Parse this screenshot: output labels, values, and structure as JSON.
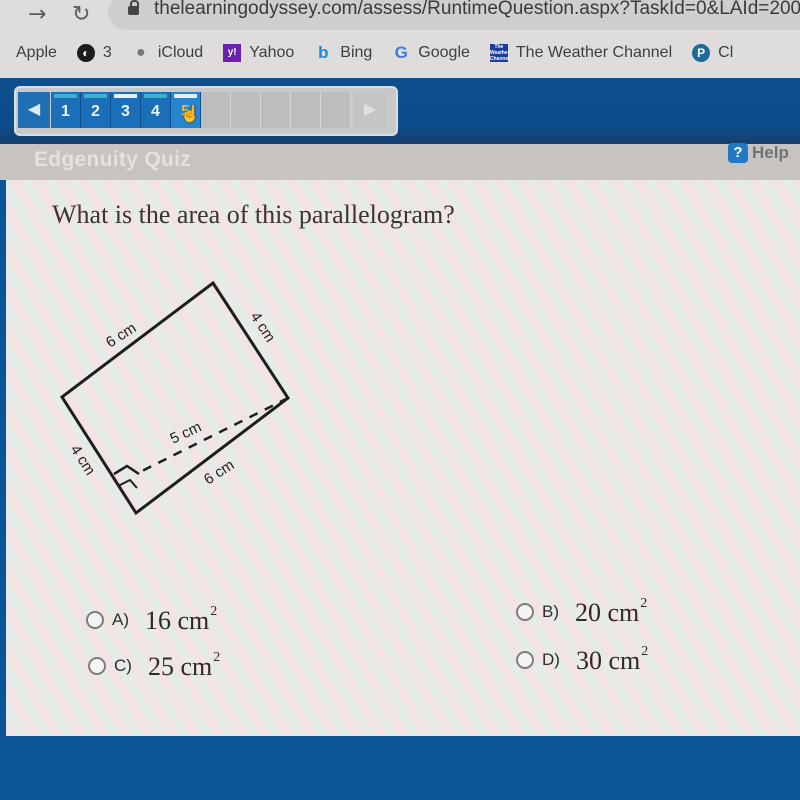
{
  "browser": {
    "url": "thelearningodyssey.com/assess/RuntimeQuestion.aspx?TaskId=0&LAId=200",
    "bookmarks": [
      {
        "icon": "apple-icon",
        "label": "Apple"
      },
      {
        "icon": "globe-icon",
        "label": "3"
      },
      {
        "icon": "apple-logo-icon",
        "label": "iCloud"
      },
      {
        "icon": "yahoo-icon",
        "label": "Yahoo"
      },
      {
        "icon": "bing-icon",
        "label": "Bing"
      },
      {
        "icon": "google-icon",
        "label": "Google"
      },
      {
        "icon": "weather-channel-icon",
        "label": "The Weather Channel"
      },
      {
        "icon": "p-icon",
        "label": "Cl"
      }
    ]
  },
  "quiz_nav": {
    "items": [
      {
        "label": "1",
        "status": "answered",
        "bar_color": "#3fb0c9"
      },
      {
        "label": "2",
        "status": "answered",
        "bar_color": "#3fb0c9"
      },
      {
        "label": "3",
        "status": "unanswered",
        "bar_color": "#e8eef3"
      },
      {
        "label": "4",
        "status": "answered",
        "bar_color": "#3fb0c9"
      },
      {
        "label": "5",
        "status": "current",
        "bar_color": "#e8eef3"
      }
    ],
    "prev_icon": "◀",
    "next_icon": "▶"
  },
  "header": {
    "title": "Edgenuity Quiz",
    "help_icon": "?",
    "help_label": "Help"
  },
  "question": {
    "text": "What is the area of this parallelogram?",
    "figure": {
      "shape": "parallelogram",
      "labels": {
        "top_side": "6 cm",
        "right_side": "4 cm",
        "left_side": "4 cm",
        "bottom_side": "6 cm",
        "height": "5 cm"
      }
    }
  },
  "choices": [
    {
      "letter": "A)",
      "value": "16 cm",
      "exponent": "2"
    },
    {
      "letter": "B)",
      "value": "20 cm",
      "exponent": "2"
    },
    {
      "letter": "C)",
      "value": "25 cm",
      "exponent": "2"
    },
    {
      "letter": "D)",
      "value": "30 cm",
      "exponent": "2"
    }
  ]
}
